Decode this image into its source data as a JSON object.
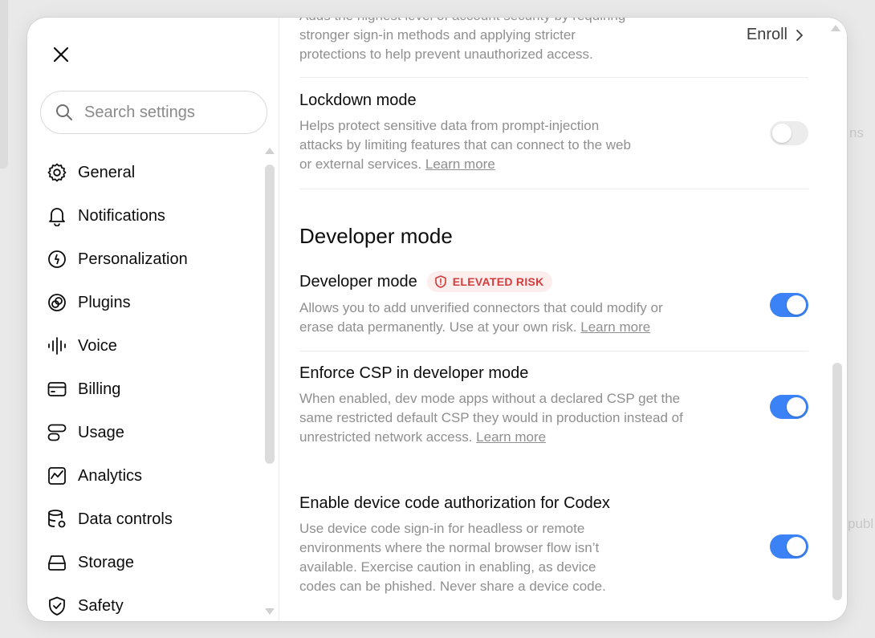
{
  "background": {
    "hint_right": "ns",
    "hint_right2": "publ"
  },
  "sidebar": {
    "search": {
      "placeholder": "Search settings",
      "value": ""
    },
    "items": [
      {
        "label": "General",
        "icon": "gear-icon"
      },
      {
        "label": "Notifications",
        "icon": "bell-icon"
      },
      {
        "label": "Personalization",
        "icon": "smiley-circle-icon"
      },
      {
        "label": "Plugins",
        "icon": "plugin-icon"
      },
      {
        "label": "Voice",
        "icon": "waveform-icon"
      },
      {
        "label": "Billing",
        "icon": "card-icon"
      },
      {
        "label": "Usage",
        "icon": "usage-icon"
      },
      {
        "label": "Analytics",
        "icon": "chart-icon"
      },
      {
        "label": "Data controls",
        "icon": "database-gear-icon"
      },
      {
        "label": "Storage",
        "icon": "drive-icon"
      },
      {
        "label": "Safety",
        "icon": "shield-check-icon"
      }
    ]
  },
  "content": {
    "advanced_security": {
      "desc_top": "Adds the highest level of account security by requiring",
      "desc_mid": "stronger sign-in methods and applying stricter",
      "desc_bot": "protections to help prevent unauthorized access.",
      "enroll_label": "Enroll"
    },
    "lockdown": {
      "title": "Lockdown mode",
      "desc": "Helps protect sensitive data from prompt-injection attacks by limiting features that can connect to the web or external services.",
      "learn_more": "Learn more",
      "enabled": false
    },
    "section_title": "Developer mode",
    "developer_mode": {
      "title": "Developer mode",
      "badge": "ELEVATED RISK",
      "desc": "Allows you to add unverified connectors that could modify or erase data permanently. Use at your own risk.",
      "learn_more": "Learn more",
      "enabled": true
    },
    "enforce_csp": {
      "title": "Enforce CSP in developer mode",
      "desc": "When enabled, dev mode apps without a declared CSP get the same restricted default CSP they would in production instead of unrestricted network access.",
      "learn_more": "Learn more",
      "enabled": true
    },
    "device_code": {
      "title": "Enable device code authorization for Codex",
      "desc": "Use device code sign-in for headless or remote environments where the normal browser flow isn’t available. Exercise caution in enabling, as device codes can be phished. Never share a device code.",
      "enabled": true
    }
  },
  "colors": {
    "toggle_on": "#3a82f6",
    "toggle_off": "#ececec",
    "badge_text": "#d23c3c",
    "badge_bg": "#fdeeee"
  }
}
